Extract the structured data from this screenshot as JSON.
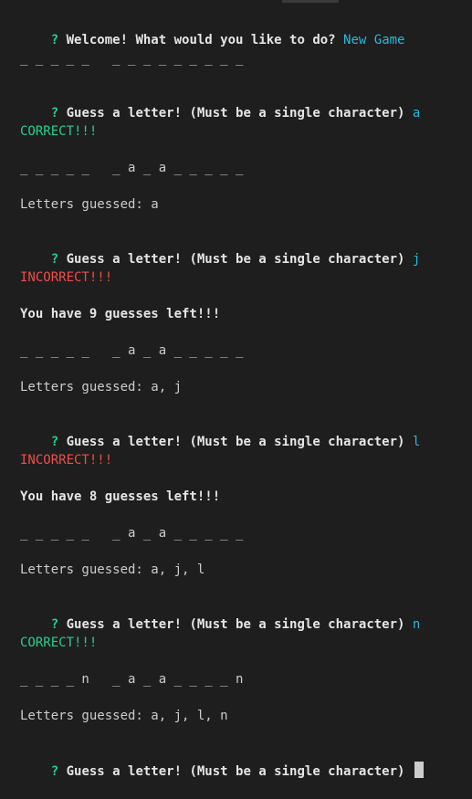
{
  "terminal": {
    "prompt_symbol": "?",
    "welcome_question": "Welcome! What would you like to do?",
    "welcome_answer": "New Game",
    "guess_question": "Guess a letter! (Must be a single character)",
    "board_0": "_ _ _ _ _   _ _ _ _ _ _ _ _ _",
    "answer_1": "a",
    "result_1": "CORRECT!!!",
    "board_1": "_ _ _ _ _   _ a _ a _ _ _ _ _",
    "guessed_1": "Letters guessed: a",
    "answer_2": "j",
    "result_2": "INCORRECT!!!",
    "remaining_2": "You have 9 guesses left!!!",
    "board_2": "_ _ _ _ _   _ a _ a _ _ _ _ _",
    "guessed_2": "Letters guessed: a, j",
    "answer_3": "l",
    "result_3": "INCORRECT!!!",
    "remaining_3": "You have 8 guesses left!!!",
    "board_3": "_ _ _ _ _   _ a _ a _ _ _ _ _",
    "guessed_3": "Letters guessed: a, j, l",
    "answer_4": "n",
    "result_4": "CORRECT!!!",
    "board_4": "_ _ _ _ n   _ a _ a _ _ _ _ n",
    "guessed_4": "Letters guessed: a, j, l, n"
  },
  "colors": {
    "background": "#1e1e1e",
    "prompt": "#23d18b",
    "answer": "#29b8db",
    "correct": "#23d18b",
    "incorrect": "#f14c4c",
    "text": "#cccccc"
  }
}
